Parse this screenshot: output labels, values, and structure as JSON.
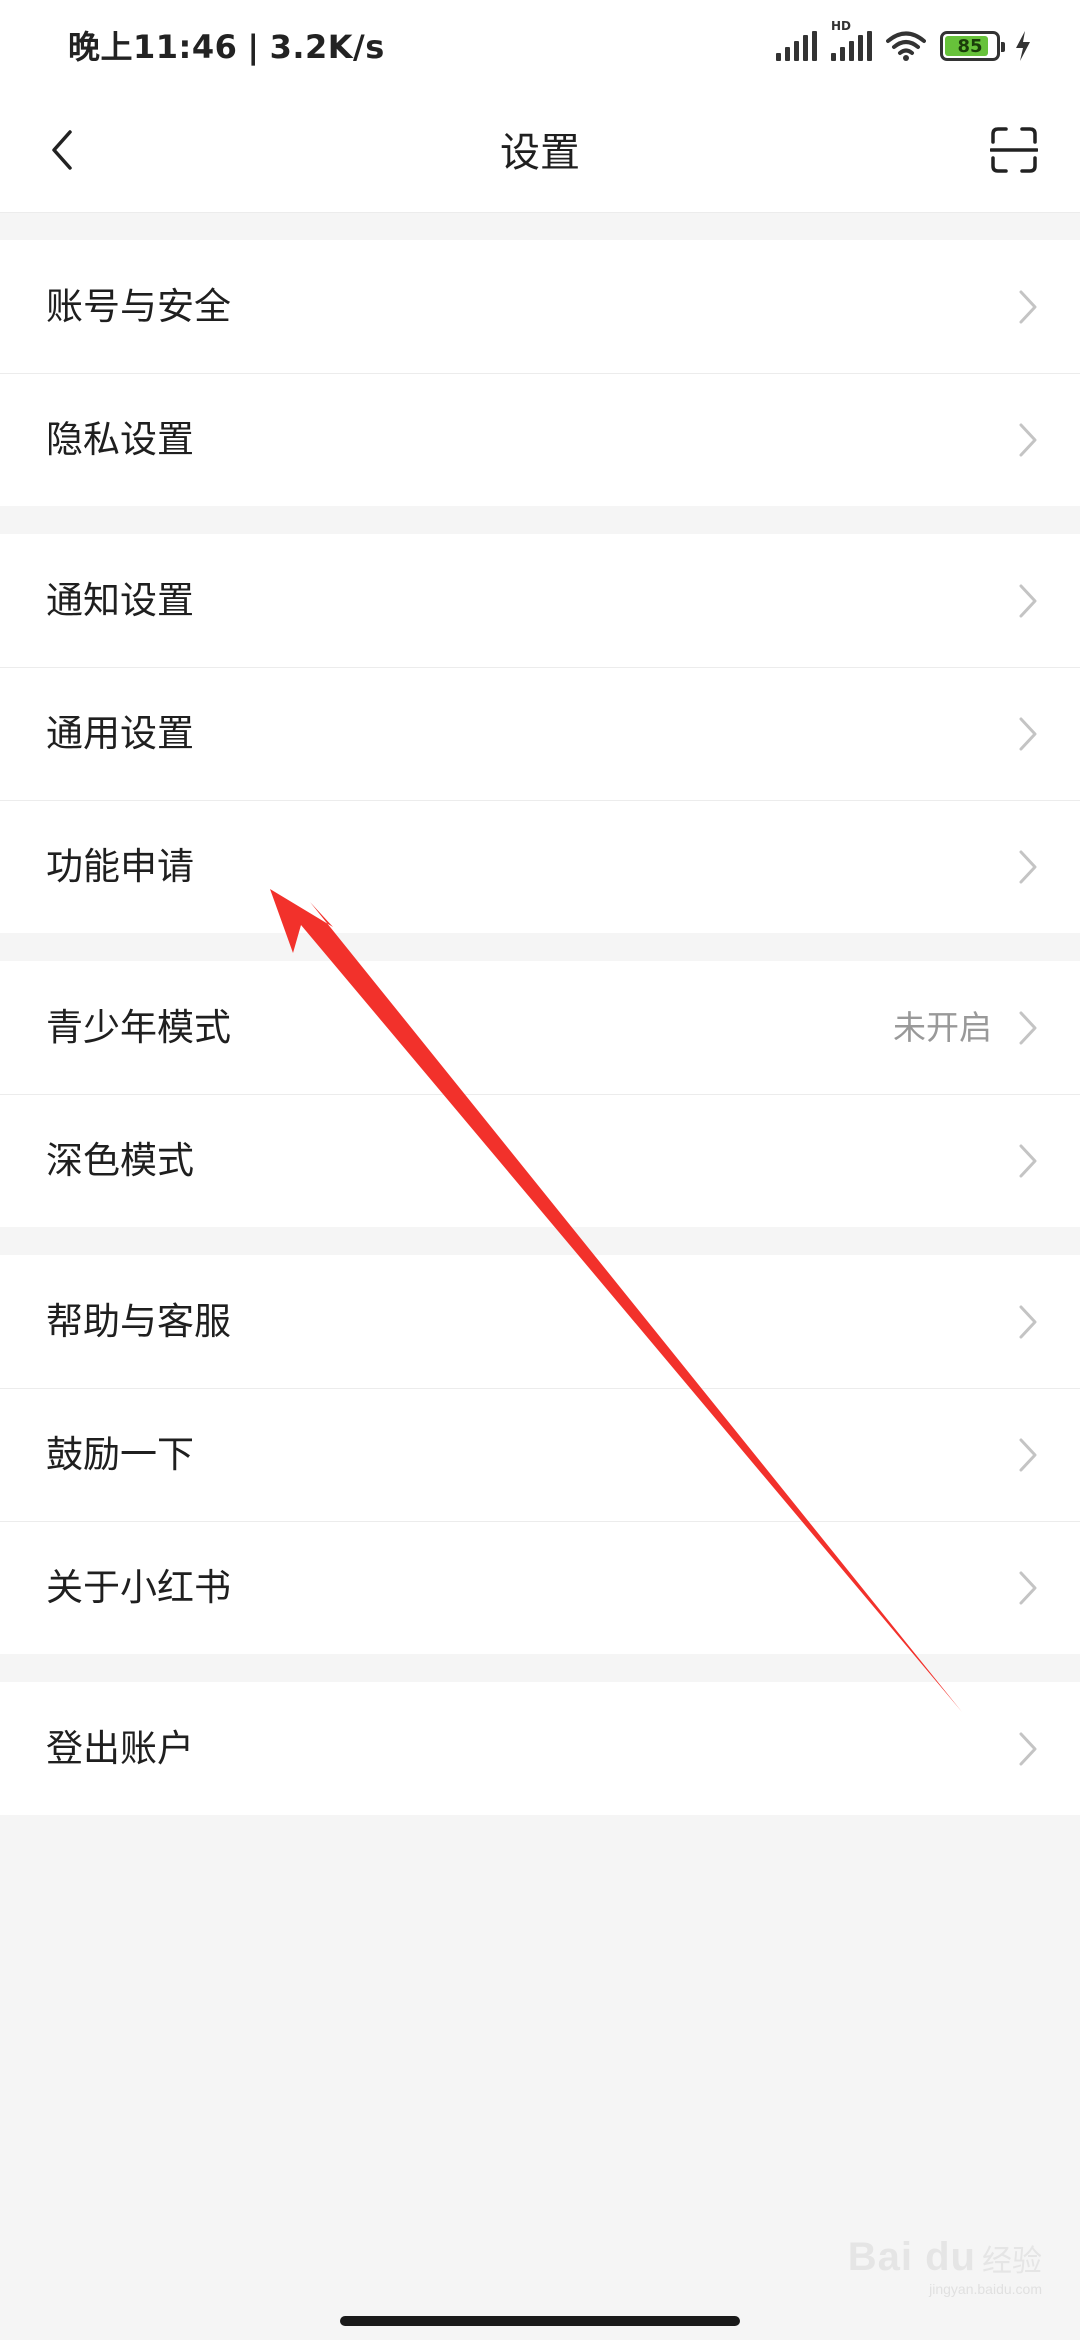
{
  "status_bar": {
    "time": "晚上11:46",
    "separator": "|",
    "net_speed": "3.2K/s",
    "hd_label": "HD",
    "battery_level": "85",
    "battery_color": "#67c23a",
    "icons": [
      "signal-icon",
      "signal-hd-icon",
      "wifi-icon",
      "battery-icon",
      "charging-icon"
    ]
  },
  "nav": {
    "title": "设置",
    "back_icon": "chevron-left-icon",
    "scan_icon": "scan-icon"
  },
  "groups": [
    {
      "items": [
        {
          "label": "账号与安全"
        },
        {
          "label": "隐私设置"
        }
      ]
    },
    {
      "items": [
        {
          "label": "通知设置"
        },
        {
          "label": "通用设置"
        },
        {
          "label": "功能申请"
        }
      ]
    },
    {
      "items": [
        {
          "label": "青少年模式",
          "value": "未开启"
        },
        {
          "label": "深色模式"
        }
      ]
    },
    {
      "items": [
        {
          "label": "帮助与客服"
        },
        {
          "label": "鼓励一下"
        },
        {
          "label": "关于小红书"
        }
      ]
    },
    {
      "items": [
        {
          "label": "登出账户"
        }
      ]
    }
  ],
  "annotation": {
    "arrow_color": "#f2312b"
  },
  "watermark": {
    "logo": "Bai du",
    "text": "经验",
    "url": "jingyan.baidu.com"
  }
}
